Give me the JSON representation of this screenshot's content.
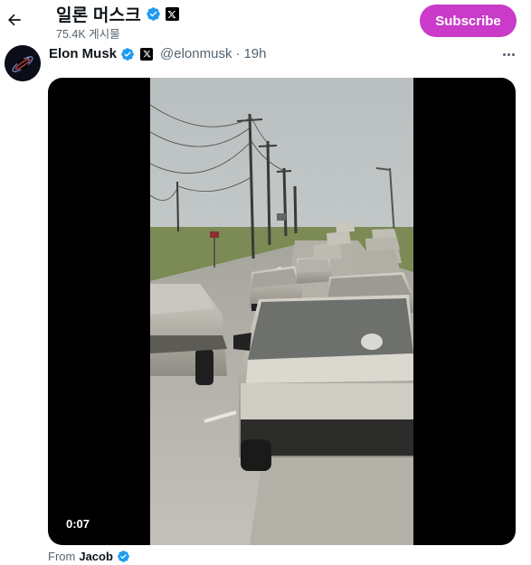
{
  "header": {
    "title": "일론 머스크",
    "posts_count": "75.4K 게시물",
    "subscribe_label": "Subscribe"
  },
  "tweet": {
    "author_name": "Elon Musk",
    "handle": "@elonmusk",
    "separator": "·",
    "time": "19h",
    "video_timestamp": "0:07",
    "from_prefix": "From",
    "from_name": "Jacob"
  },
  "icons": {
    "back": "back-arrow-icon",
    "verified": "verified-badge-icon",
    "x_logo": "x-logo-icon",
    "more": "more-icon"
  },
  "colors": {
    "subscribe_bg": "#c93bc8",
    "verified_blue": "#1d9bf0",
    "muted_text": "#536471"
  }
}
